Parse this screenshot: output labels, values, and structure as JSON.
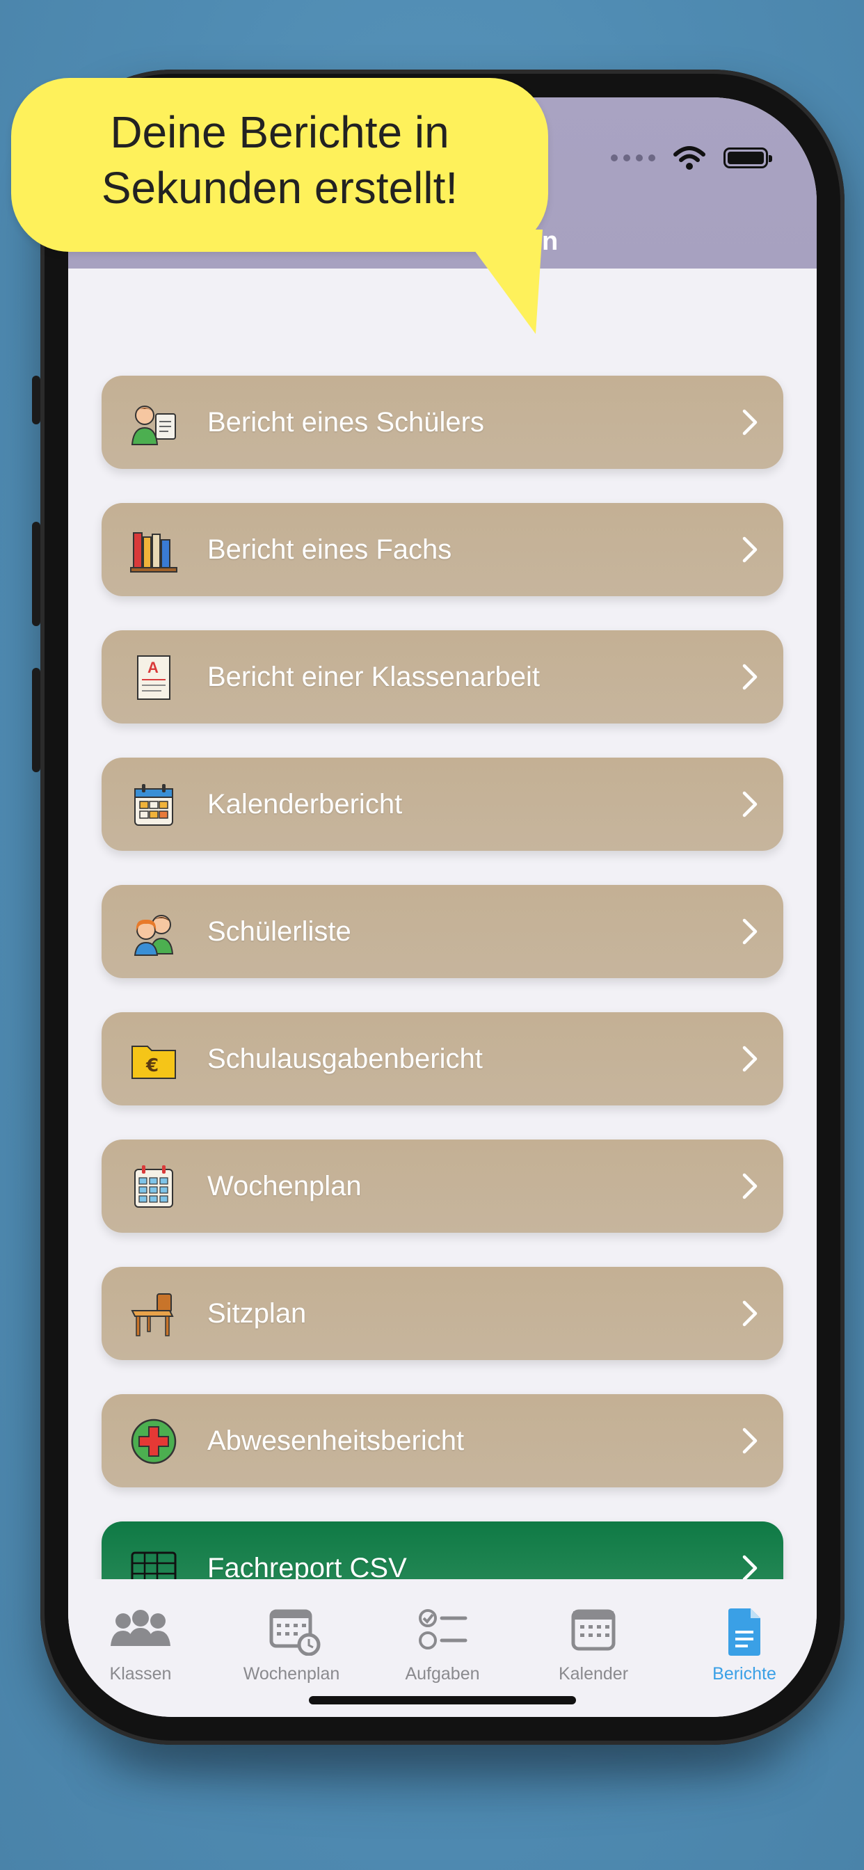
{
  "callout": {
    "line1": "Deine Berichte in",
    "line2": "Sekunden erstellt!"
  },
  "nav": {
    "title_partial": "eren"
  },
  "rows": [
    {
      "label": "Bericht eines Schülers",
      "icon": "student-report-icon"
    },
    {
      "label": "Bericht eines Fachs",
      "icon": "books-icon"
    },
    {
      "label": "Bericht einer Klassenarbeit",
      "icon": "graded-test-icon"
    },
    {
      "label": "Kalenderbericht",
      "icon": "calendar-icon"
    },
    {
      "label": "Schülerliste",
      "icon": "students-icon"
    },
    {
      "label": "Schulausgabenbericht",
      "icon": "euro-folder-icon"
    },
    {
      "label": "Wochenplan",
      "icon": "week-calendar-icon"
    },
    {
      "label": "Sitzplan",
      "icon": "desk-chair-icon"
    },
    {
      "label": "Abwesenheitsbericht",
      "icon": "medical-cross-icon"
    },
    {
      "label": "Fachreport CSV",
      "icon": "spreadsheet-icon"
    }
  ],
  "tabs": [
    {
      "label": "Klassen",
      "icon": "people-icon"
    },
    {
      "label": "Wochenplan",
      "icon": "week-clock-icon"
    },
    {
      "label": "Aufgaben",
      "icon": "checklist-icon"
    },
    {
      "label": "Kalender",
      "icon": "calendar-icon"
    },
    {
      "label": "Berichte",
      "icon": "document-icon"
    }
  ],
  "colors": {
    "background": "#4f8bb2",
    "row": "#c4b094",
    "row_csv": "#0f7a45",
    "accent_active_tab": "#3aa0e6",
    "callout": "#fef15b",
    "nav_bar": "#a9a3c2"
  }
}
